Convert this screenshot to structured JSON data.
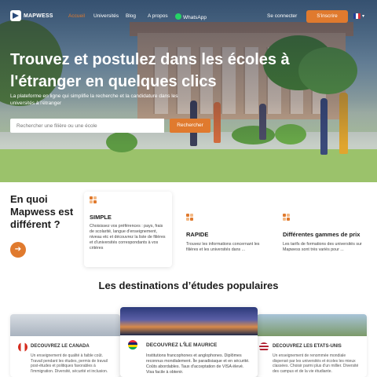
{
  "brand": {
    "name": "MAPWESS"
  },
  "nav": {
    "links": [
      {
        "label": "Accueil",
        "active": true
      },
      {
        "label": "Universités"
      },
      {
        "label": "Blog"
      },
      {
        "label": "A propos"
      },
      {
        "label": "WhatsApp",
        "icon": "whatsapp-icon"
      }
    ],
    "login_label": "Se connecter",
    "signup_label": "S'inscrire",
    "language_flag": "france-flag-icon"
  },
  "hero": {
    "title": "Trouvez et postulez dans les écoles à l'étranger en quelques clics",
    "subtitle": "La plateforme en ligne qui simplifie la recherche et la candidature dans les universités à l'étranger",
    "search_placeholder": "Rechercher une filière ou une école",
    "search_button": "Rechercher"
  },
  "different": {
    "title": "En quoi Mapwess est différent ?",
    "arrow_icon": "arrow-right-icon",
    "features": [
      {
        "title": "SIMPLE",
        "description": "Choisissez vos préférences : pays, frais de scolarité, langue d'enseignement, niveau etc et découvrez la liste de filières et d'universités correspondants à vos critères"
      },
      {
        "title": "RAPIDE",
        "description": "Trouvez les informations concernant les filières et les universités dans ..."
      },
      {
        "title": "Différentes gammes de prix",
        "description": "Les tarifs de formations des universités sur Mapwess sont très variés pour ..."
      }
    ]
  },
  "destinations": {
    "title": "Les destinations d’études populaires",
    "cards": [
      {
        "name": "DECOUVREZ LE CANADA",
        "flag": "canada-flag-icon",
        "description": "Un enseignement de qualité à faible coût. Travail pendant les études, permis de travail post-études et politiques favorables à l'immigration. Diversité, sécurité et inclusion."
      },
      {
        "name": "DECOUVREZ L'ÎLE MAURICE",
        "flag": "mauritius-flag-icon",
        "description": "Institutions francophones et anglophones. Diplômes reconnus mondialement. Île paradisiaque et en sécurité. Coûts abordables. Taux d'acceptation de VISA élevé. Visa facile à obtenir."
      },
      {
        "name": "DECOUVREZ LES ETATS-UNIS",
        "flag": "usa-flag-icon",
        "description": "Un enseignement de renommée mondiale dispensé par les universités et écoles les mieux classées. Choisir parmi plus d'un millier. Diversité des campus et de la vie étudiante."
      }
    ]
  },
  "colors": {
    "accent": "#e07a2e",
    "dark_text": "#1c1c1c"
  }
}
